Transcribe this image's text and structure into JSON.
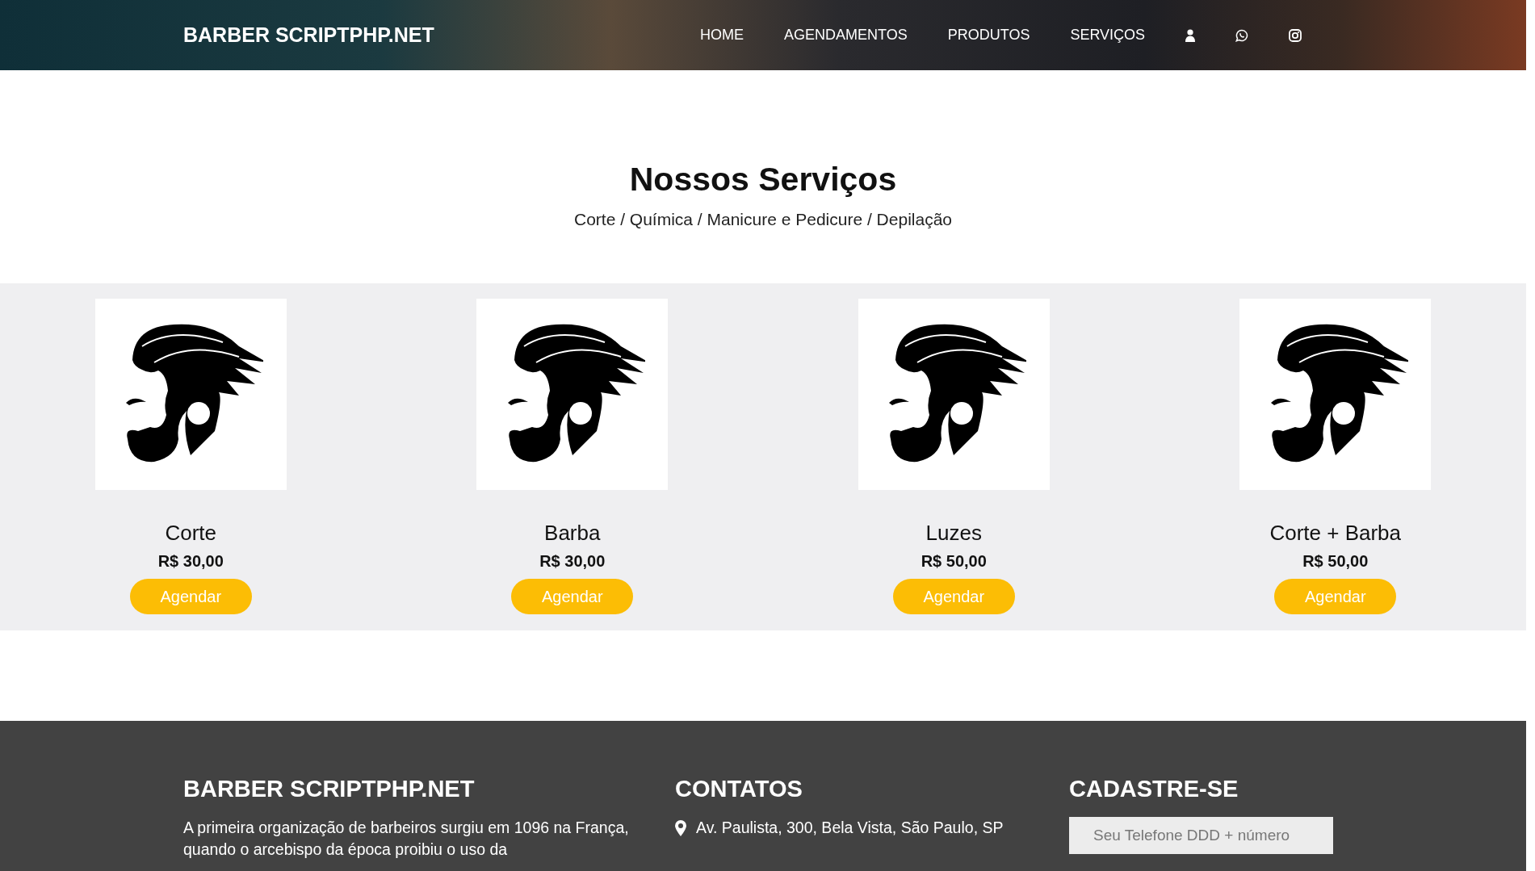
{
  "header": {
    "logo": "BARBER SCRIPTPHP.NET",
    "nav": [
      "HOME",
      "AGENDAMENTOS",
      "PRODUTOS",
      "SERVIÇOS"
    ]
  },
  "intro": {
    "title": "Nossos Serviços",
    "subtitle": "Corte / Química / Manicure e Pedicure / Depilação"
  },
  "services": [
    {
      "name": "Corte",
      "price": "R$ 30,00",
      "button": "Agendar"
    },
    {
      "name": "Barba",
      "price": "R$ 30,00",
      "button": "Agendar"
    },
    {
      "name": "Luzes",
      "price": "R$ 50,00",
      "button": "Agendar"
    },
    {
      "name": "Corte + Barba",
      "price": "R$ 50,00",
      "button": "Agendar"
    }
  ],
  "footer": {
    "about": {
      "title": "BARBER SCRIPTPHP.NET",
      "text": "A primeira organização de barbeiros surgiu em 1096 na França, quando o arcebispo da época proibiu o uso da"
    },
    "contacts": {
      "title": "CONTATOS",
      "items": [
        "Av. Paulista, 300, Bela Vista, São Paulo, SP"
      ]
    },
    "signup": {
      "title": "CADASTRE-SE",
      "placeholder": "Seu Telefone DDD + número"
    }
  }
}
